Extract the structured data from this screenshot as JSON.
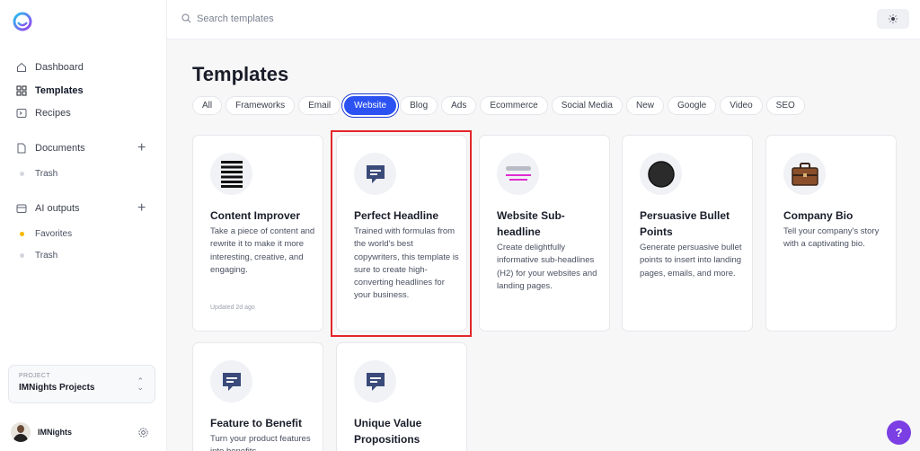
{
  "sidebar": {
    "nav": [
      {
        "label": "Dashboard",
        "icon": "home-icon"
      },
      {
        "label": "Templates",
        "icon": "grid-icon"
      },
      {
        "label": "Recipes",
        "icon": "recipe-icon"
      }
    ],
    "documents": {
      "label": "Documents",
      "icon": "document-icon",
      "children": [
        {
          "label": "Trash"
        }
      ]
    },
    "ai_outputs": {
      "label": "AI outputs",
      "icon": "folder-icon",
      "children": [
        {
          "label": "Favorites"
        },
        {
          "label": "Trash"
        }
      ]
    },
    "project": {
      "caption": "PROJECT",
      "name": "IMNights Projects"
    },
    "user": {
      "name": "IMNights"
    }
  },
  "search": {
    "placeholder": "Search templates"
  },
  "main": {
    "title": "Templates",
    "tabs": [
      "All",
      "Frameworks",
      "Email",
      "Website",
      "Blog",
      "Ads",
      "Ecommerce",
      "Social Media",
      "New",
      "Google",
      "Video",
      "SEO"
    ],
    "active_tab": "Website",
    "cards": [
      {
        "title": "Content Improver",
        "description": "Take a piece of content and rewrite it to make it more interesting, creative, and engaging.",
        "updated": "Updated 2d ago",
        "icon": "bars-icon"
      },
      {
        "title": "Perfect Headline",
        "description": "Trained with formulas from the world's best copywriters, this template is sure to create high-converting headlines for your business.",
        "icon": "chat-bubble-icon"
      },
      {
        "title": "Website Sub-headline",
        "description": "Create delightfully informative sub-headlines (H2) for your websites and landing pages.",
        "icon": "subheadline-icon"
      },
      {
        "title": "Persuasive Bullet Points",
        "description": "Generate persuasive bullet points to insert into landing pages, emails, and more.",
        "icon": "bullet-icon"
      },
      {
        "title": "Company Bio",
        "description": "Tell your company's story with a captivating bio.",
        "icon": "briefcase-icon"
      },
      {
        "title": "Feature to Benefit",
        "description": "Turn your product features into benefits",
        "icon": "chat-bubble-icon"
      },
      {
        "title": "Unique Value Propositions",
        "description": "",
        "icon": "chat-bubble-icon"
      }
    ]
  },
  "help": {
    "label": "?"
  },
  "colors": {
    "accent": "#2c52f2",
    "highlight": "#e3262b",
    "help": "#7b3fe4"
  }
}
